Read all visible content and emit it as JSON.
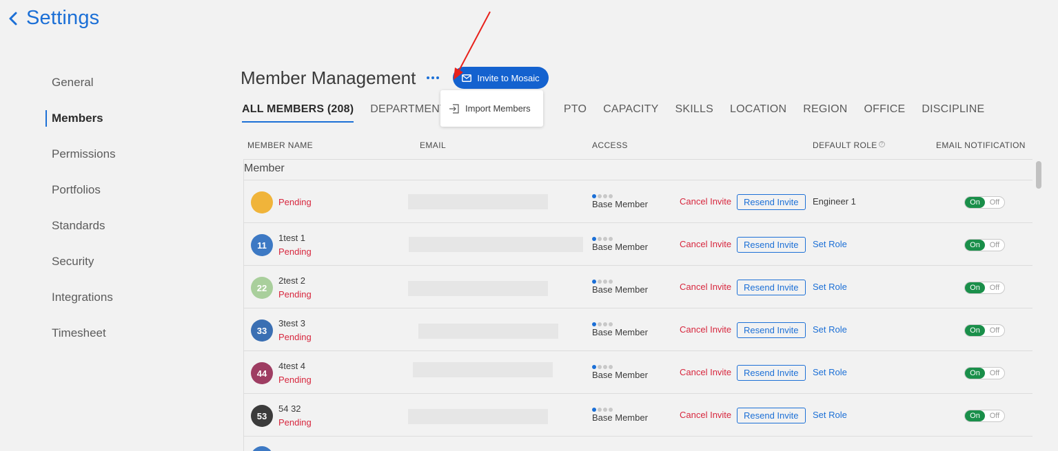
{
  "header": {
    "back_title": "Settings"
  },
  "sidebar": {
    "items": [
      {
        "label": "General",
        "active": false
      },
      {
        "label": "Members",
        "active": true
      },
      {
        "label": "Permissions",
        "active": false
      },
      {
        "label": "Portfolios",
        "active": false
      },
      {
        "label": "Standards",
        "active": false
      },
      {
        "label": "Security",
        "active": false
      },
      {
        "label": "Integrations",
        "active": false
      },
      {
        "label": "Timesheet",
        "active": false
      }
    ]
  },
  "main": {
    "title": "Member Management",
    "invite_button": "Invite to Mosaic",
    "more_menu": {
      "import_label": "Import Members"
    },
    "tabs": [
      "ALL MEMBERS (208)",
      "DEPARTMENT (",
      "PTO",
      "CAPACITY",
      "SKILLS",
      "LOCATION",
      "REGION",
      "OFFICE",
      "DISCIPLINE"
    ],
    "columns": {
      "member_name": "MEMBER NAME",
      "email": "EMAIL",
      "access": "ACCESS",
      "default_role": "DEFAULT ROLE",
      "email_notification": "EMAIL NOTIFICATION"
    },
    "group_label": "Member",
    "rows": [
      {
        "initials": "",
        "name": "",
        "status": "Pending",
        "access": "Base Member",
        "cancel": "Cancel Invite",
        "resend": "Resend Invite",
        "role": "Engineer 1",
        "role_is_link": false,
        "notif_on": "On",
        "notif_off": "Off",
        "avatar_color": "#f0b43a"
      },
      {
        "initials": "11",
        "name": "1test 1",
        "status": "Pending",
        "access": "Base Member",
        "cancel": "Cancel Invite",
        "resend": "Resend Invite",
        "role": "Set Role",
        "role_is_link": true,
        "notif_on": "On",
        "notif_off": "Off",
        "avatar_color": "#3d79c4"
      },
      {
        "initials": "22",
        "name": "2test 2",
        "status": "Pending",
        "access": "Base Member",
        "cancel": "Cancel Invite",
        "resend": "Resend Invite",
        "role": "Set Role",
        "role_is_link": true,
        "notif_on": "On",
        "notif_off": "Off",
        "avatar_color": "#a9cf9c"
      },
      {
        "initials": "33",
        "name": "3test 3",
        "status": "Pending",
        "access": "Base Member",
        "cancel": "Cancel Invite",
        "resend": "Resend Invite",
        "role": "Set Role",
        "role_is_link": true,
        "notif_on": "On",
        "notif_off": "Off",
        "avatar_color": "#3a6fb3"
      },
      {
        "initials": "44",
        "name": "4test 4",
        "status": "Pending",
        "access": "Base Member",
        "cancel": "Cancel Invite",
        "resend": "Resend Invite",
        "role": "Set Role",
        "role_is_link": true,
        "notif_on": "On",
        "notif_off": "Off",
        "avatar_color": "#9e3d62"
      },
      {
        "initials": "53",
        "name": "54 32",
        "status": "Pending",
        "access": "Base Member",
        "cancel": "Cancel Invite",
        "resend": "Resend Invite",
        "role": "Set Role",
        "role_is_link": true,
        "notif_on": "On",
        "notif_off": "Off",
        "avatar_color": "#3b3b3b"
      }
    ]
  },
  "colors": {
    "accent": "#1b6fd6",
    "pending": "#d7263d",
    "toggle_on": "#1a8f4a",
    "annotation_arrow": "#e8211b"
  }
}
